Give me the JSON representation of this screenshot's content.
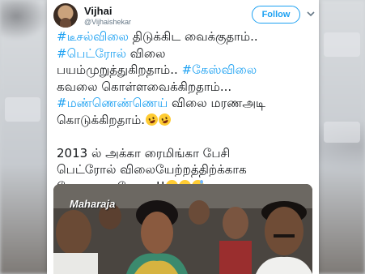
{
  "tweet": {
    "display_name": "Vijhai",
    "handle": "@Vijhaishekar",
    "follow_label": "Follow",
    "lines": [
      [
        {
          "t": "#டீசல்விலை",
          "h": true
        },
        {
          "t": " திடுக்கிட வைக்குதாம்..",
          "h": false
        }
      ],
      [
        {
          "t": "#பெட்ரோல்",
          "h": true
        },
        {
          "t": " விலை",
          "h": false
        }
      ],
      [
        {
          "t": "பயம்முறுத்துகிறதாம்.. ",
          "h": false
        },
        {
          "t": "#கேஸ்விலை",
          "h": true
        }
      ],
      [
        {
          "t": "கவலை கொள்ளவைக்கிறதாம்...",
          "h": false
        }
      ],
      [
        {
          "t": "#மண்ணெண்ணெய்",
          "h": true
        },
        {
          "t": " விலை மரணஅடி",
          "h": false
        }
      ],
      [
        {
          "t": "கொடுக்கிறதாம்.",
          "h": false
        }
      ],
      [
        {
          "t": "",
          "h": false
        }
      ],
      [
        {
          "t": "2013 ல் அக்கா ரைமிங்கா பேசி",
          "h": false
        }
      ],
      [
        {
          "t": "பெட்ரோல் விலையேற்றத்திற்க்காக",
          "h": false
        }
      ],
      [
        {
          "t": "போராடிய போது.!!",
          "h": false
        }
      ]
    ],
    "emoji_groups": {
      "5": [
        "rofl",
        "rofl"
      ],
      "9": [
        "grin",
        "grin",
        "sweat"
      ]
    }
  },
  "media": {
    "watermark": "Maharaja"
  },
  "colors": {
    "hashtag": "#1da1f2",
    "text": "#14171a",
    "muted": "#657786"
  }
}
